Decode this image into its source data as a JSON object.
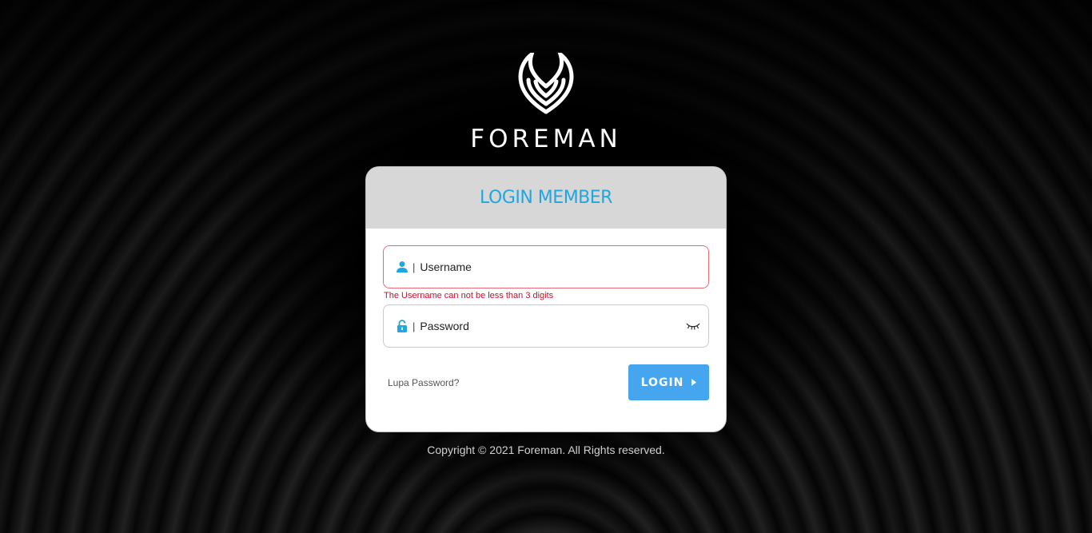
{
  "brand": {
    "name": "FOREMAN",
    "logo_icon": "wing-leaf-logo-icon"
  },
  "login_card": {
    "title": "LOGIN MEMBER",
    "username": {
      "placeholder": "Username",
      "value": "",
      "icon": "user-icon",
      "separator": "|",
      "error": "The Username can not be less than 3 digits"
    },
    "password": {
      "placeholder": "Password",
      "value": "",
      "icon": "lock-icon",
      "separator": "|",
      "toggle_icon": "eye-closed-icon"
    },
    "forgot_label": "Lupa Password?",
    "login_label": "LOGIN",
    "login_icon": "caret-right-icon"
  },
  "footer": {
    "copyright": "Copyright © 2021 Foreman. All Rights reserved."
  },
  "colors": {
    "accent": "#1ea7e0",
    "button": "#45a6ef",
    "error": "#c8102e",
    "error_border": "#e76b77",
    "header_bg": "#d7d7d7"
  }
}
